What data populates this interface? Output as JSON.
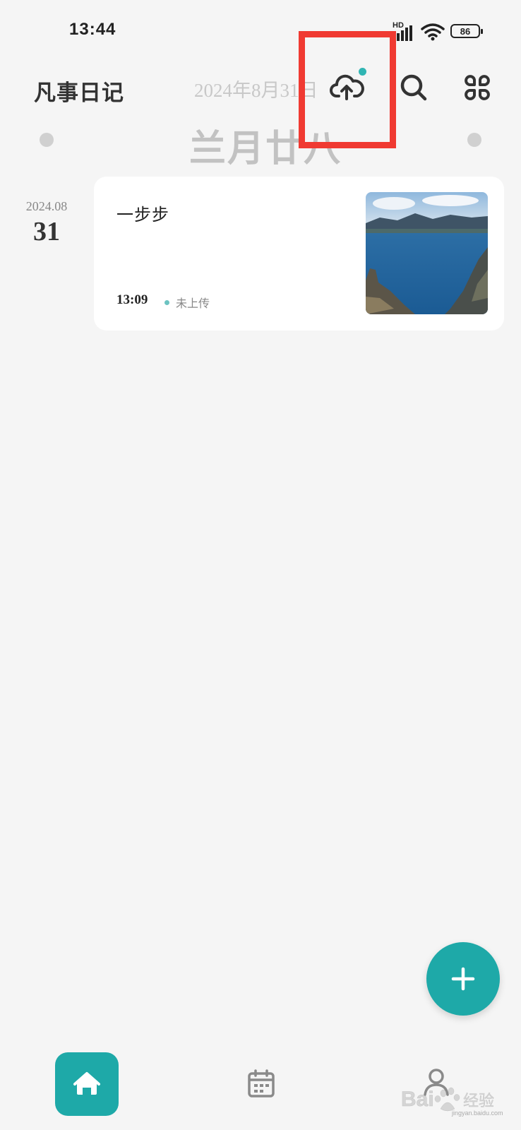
{
  "status_bar": {
    "time": "13:44",
    "network_label": "HD",
    "battery": "86",
    "icons": [
      "signal-icon",
      "wifi-icon",
      "battery-icon"
    ]
  },
  "header": {
    "app_title": "凡事日记",
    "date": "2024年8月31日",
    "lunar_date": "兰月廿八",
    "icons": [
      "cloud-upload-icon",
      "search-icon",
      "grid-menu-icon"
    ],
    "accent_color": "#1ea9a8",
    "highlight_color": "#f03a32"
  },
  "entries": [
    {
      "year_month": "2024.08",
      "day": "31",
      "title": "一步步",
      "time": "13:09",
      "upload_status": "未上传",
      "photo": "lake-landscape-photo"
    }
  ],
  "fab": {
    "icon": "plus-icon"
  },
  "bottom_nav": {
    "items": [
      {
        "icon": "home-icon",
        "active": true
      },
      {
        "icon": "calendar-icon",
        "active": false
      },
      {
        "icon": "profile-icon",
        "active": false
      }
    ]
  },
  "watermark": {
    "brand": "Bai",
    "suffix": "经验",
    "url": "jingyan.baidu.com"
  }
}
